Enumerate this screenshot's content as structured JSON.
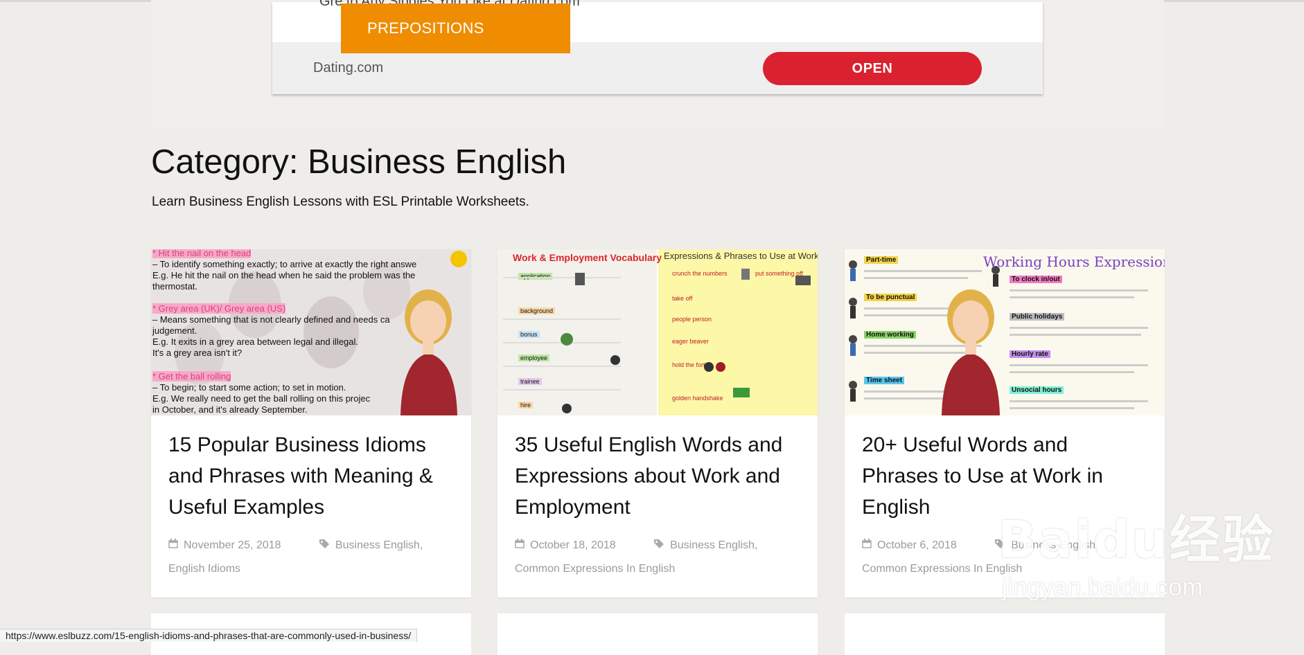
{
  "ad": {
    "top_text": "Gre                                      to Any Singles You Like at Dating.com",
    "brand": "Dating.com",
    "open_label": "OPEN",
    "prepositions_label": "PREPOSITIONS"
  },
  "category": {
    "title": "Category: Business English",
    "description": "Learn Business English Lessons with ESL Printable Worksheets."
  },
  "cards": [
    {
      "title": "15 Popular Business Idioms and Phrases with Meaning & Useful Examples",
      "date": "November 25, 2018",
      "tags": "Business English,",
      "tags2": "English Idioms",
      "image_text": {
        "h1": "* Hit the nail on the head",
        "l1": "– To identify something exactly; to arrive at exactly the right answe",
        "l2": "E.g. He hit the nail on the head when he said the problem was the",
        "l3": "thermostat.",
        "h2": "* Grey area (UK)/ Grey area (US)",
        "l4": "– Means something that is not clearly defined and needs ca",
        "l5": "judgement.",
        "l6": "E.g. It exits in a grey area between legal and illegal.",
        "l7": "It's a grey area isn't it?",
        "h3": "* Get the ball rolling",
        "l8": "– To begin; to start some action; to set in motion.",
        "l9": "E.g. We really need to get the ball rolling on this projec",
        "l10": "in October, and it's already September."
      }
    },
    {
      "title": "35 Useful English Words and Expressions about Work and Employment",
      "date": "October 18, 2018",
      "tags": "Business English,",
      "tags2": "Common Expressions In English",
      "image_text": {
        "left_title": "Work & Employment Vocabulary",
        "right_title": "Expressions & Phrases to Use at Work",
        "w1": "application",
        "w2": "background",
        "w3": "bonus",
        "w4": "employee",
        "w5": "trainee",
        "w6": "hire",
        "r1": "crunch the numbers",
        "r2": "put something off",
        "r3": "take off",
        "r4": "people person",
        "r5": "eager beaver",
        "r6": "hold the fort",
        "r7": "golden handshake"
      }
    },
    {
      "title": "20+ Useful Words and Phrases to Use at Work in English",
      "date": "October 6, 2018",
      "tags": "Business English,",
      "tags2": "Common Expressions In English",
      "image_text": {
        "title": "Working Hours Expressions",
        "a": "Part-time",
        "b": "To be punctual",
        "c": "Home working",
        "d": "Time sheet",
        "e": "To clock in/out",
        "f": "Public holidays",
        "g": "Hourly rate",
        "h": "Unsocial hours"
      }
    }
  ],
  "status_url": "https://www.eslbuzz.com/15-english-idioms-and-phrases-that-are-commonly-used-in-business/",
  "watermark": {
    "big": "Baidu经验",
    "small": "jingyan.baidu.com"
  },
  "colors": {
    "accent_orange": "#ef8c00",
    "open_red": "#d92130",
    "background": "#efedea"
  }
}
